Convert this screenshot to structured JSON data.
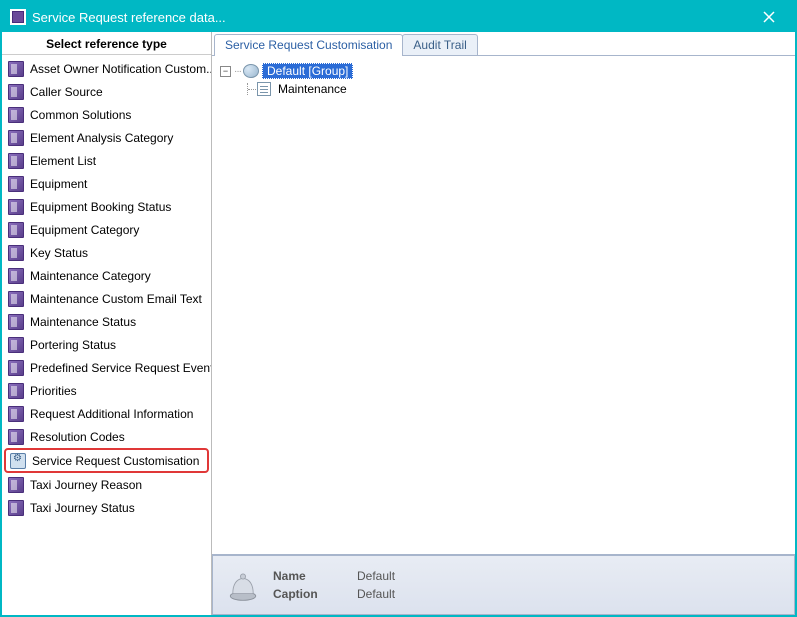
{
  "window": {
    "title": "Service Request reference data..."
  },
  "sidebar": {
    "header": "Select reference type",
    "items": [
      {
        "label": "Asset Owner Notification Custom...",
        "icon": "book"
      },
      {
        "label": "Caller Source",
        "icon": "book"
      },
      {
        "label": "Common Solutions",
        "icon": "book"
      },
      {
        "label": "Element Analysis Category",
        "icon": "book"
      },
      {
        "label": "Element List",
        "icon": "book"
      },
      {
        "label": "Equipment",
        "icon": "book"
      },
      {
        "label": "Equipment Booking Status",
        "icon": "book"
      },
      {
        "label": "Equipment Category",
        "icon": "book"
      },
      {
        "label": "Key Status",
        "icon": "book"
      },
      {
        "label": "Maintenance Category",
        "icon": "book"
      },
      {
        "label": "Maintenance Custom Email Text",
        "icon": "book"
      },
      {
        "label": "Maintenance Status",
        "icon": "book"
      },
      {
        "label": "Portering Status",
        "icon": "book"
      },
      {
        "label": "Predefined Service Request Events",
        "icon": "book"
      },
      {
        "label": "Priorities",
        "icon": "book"
      },
      {
        "label": "Request Additional Information",
        "icon": "book"
      },
      {
        "label": "Resolution Codes",
        "icon": "book"
      },
      {
        "label": "Service Request Customisation",
        "icon": "gear",
        "highlighted": true
      },
      {
        "label": "Taxi Journey Reason",
        "icon": "book"
      },
      {
        "label": "Taxi Journey Status",
        "icon": "book"
      }
    ]
  },
  "tabs": [
    {
      "label": "Service Request Customisation",
      "active": true
    },
    {
      "label": "Audit Trail",
      "active": false
    }
  ],
  "tree": {
    "root_label": "Default [Group]",
    "child_label": "Maintenance"
  },
  "detail": {
    "name_label": "Name",
    "name_value": "Default",
    "caption_label": "Caption",
    "caption_value": "Default"
  }
}
